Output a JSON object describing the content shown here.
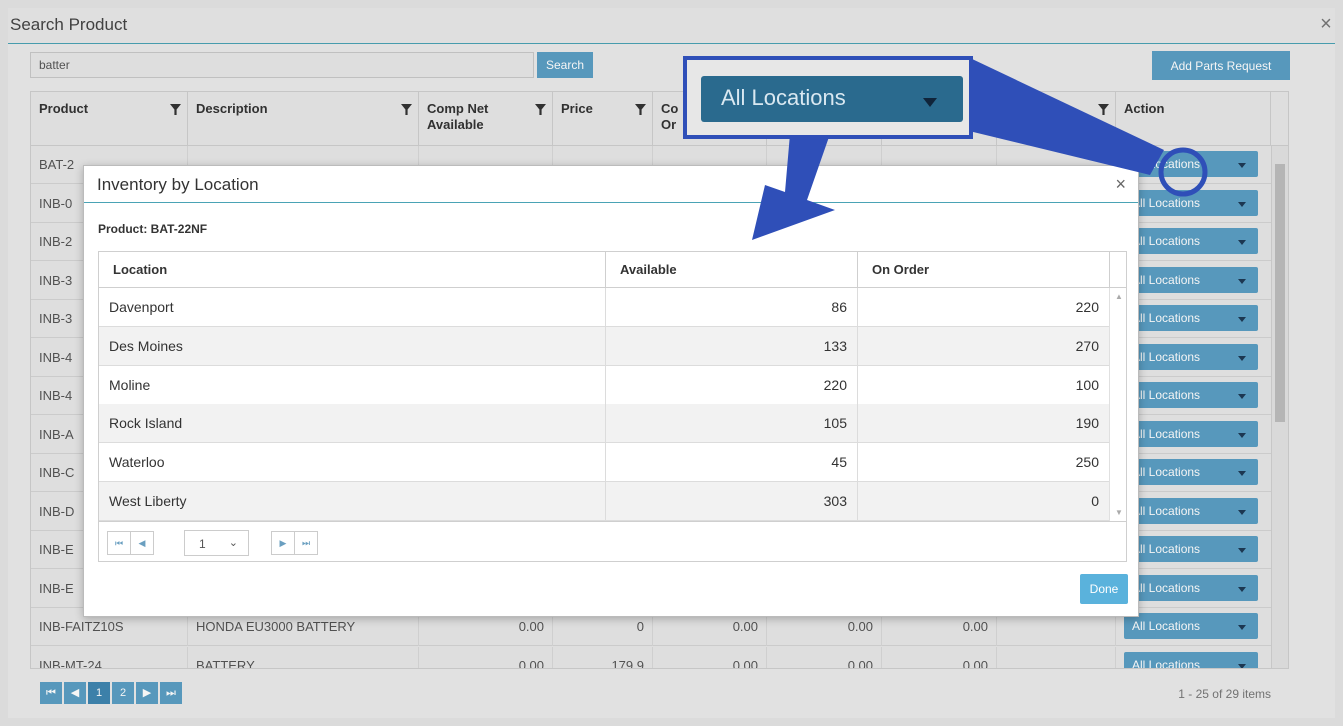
{
  "outer": {
    "title": "Search Product",
    "search_value": "batter",
    "search_button": "Search",
    "add_parts_button": "Add Parts Request",
    "columns": [
      "Product",
      "Description",
      "Comp Net Available",
      "Price",
      "Co Or",
      "Action"
    ],
    "rows": [
      {
        "product": "BAT-2",
        "description": "",
        "n1": "",
        "n2": "",
        "n3": "",
        "n4": "",
        "n5": "",
        "action": "All Locations"
      },
      {
        "product": "INB-0",
        "description": "",
        "n1": "",
        "n2": "",
        "n3": "",
        "n4": "",
        "n5": "",
        "action": "All Locations"
      },
      {
        "product": "INB-2",
        "description": "",
        "n1": "",
        "n2": "",
        "n3": "",
        "n4": "",
        "n5": "",
        "action": "All Locations"
      },
      {
        "product": "INB-3",
        "description": "",
        "n1": "",
        "n2": "",
        "n3": "",
        "n4": "",
        "n5": "",
        "action": "All Locations"
      },
      {
        "product": "INB-3",
        "description": "",
        "n1": "",
        "n2": "",
        "n3": "",
        "n4": "",
        "n5": "",
        "action": "All Locations"
      },
      {
        "product": "INB-4",
        "description": "",
        "n1": "",
        "n2": "",
        "n3": "",
        "n4": "",
        "n5": "",
        "action": "All Locations"
      },
      {
        "product": "INB-4",
        "description": "",
        "n1": "",
        "n2": "",
        "n3": "",
        "n4": "",
        "n5": "",
        "action": "All Locations"
      },
      {
        "product": "INB-A",
        "description": "",
        "n1": "",
        "n2": "",
        "n3": "",
        "n4": "",
        "n5": "",
        "action": "All Locations"
      },
      {
        "product": "INB-C",
        "description": "",
        "n1": "",
        "n2": "",
        "n3": "",
        "n4": "",
        "n5": "",
        "action": "All Locations"
      },
      {
        "product": "INB-D",
        "description": "",
        "n1": "",
        "n2": "",
        "n3": "",
        "n4": "",
        "n5": "",
        "action": "All Locations"
      },
      {
        "product": "INB-E",
        "description": "",
        "n1": "",
        "n2": "",
        "n3": "",
        "n4": "",
        "n5": "",
        "action": "All Locations"
      },
      {
        "product": "INB-E",
        "description": "",
        "n1": "",
        "n2": "",
        "n3": "",
        "n4": "",
        "n5": "",
        "action": "All Locations"
      },
      {
        "product": "INB-FAITZ10S",
        "description": "HONDA EU3000 BATTERY",
        "n1": "0.00",
        "n2": "0",
        "n3": "0.00",
        "n4": "0.00",
        "n5": "0.00",
        "action": "All Locations"
      },
      {
        "product": "INB-MT-24",
        "description": "BATTERY",
        "n1": "0.00",
        "n2": "179.9",
        "n3": "0.00",
        "n4": "0.00",
        "n5": "0.00",
        "action": "All Locations"
      }
    ],
    "pager": {
      "pages": [
        "1",
        "2"
      ],
      "info": "1 - 25 of 29 items"
    }
  },
  "modal": {
    "title": "Inventory by Location",
    "product_label": "Product: BAT-22NF",
    "columns": [
      "Location",
      "Available",
      "On Order"
    ],
    "rows": [
      {
        "location": "Davenport",
        "available": "86",
        "on_order": "220"
      },
      {
        "location": "Des Moines",
        "available": "133",
        "on_order": "270"
      },
      {
        "location": "Moline",
        "available": "220",
        "on_order": "100"
      },
      {
        "location": "Rock Island",
        "available": "105",
        "on_order": "190"
      },
      {
        "location": "Waterloo",
        "available": "45",
        "on_order": "250"
      },
      {
        "location": "West Liberty",
        "available": "303",
        "on_order": "0"
      }
    ],
    "page_select": "1",
    "done_button": "Done"
  },
  "callout": {
    "label": "All Locations"
  },
  "colors": {
    "accent": "#5b9fc4",
    "callout": "#2f4fb8",
    "done": "#5ab2dc"
  }
}
